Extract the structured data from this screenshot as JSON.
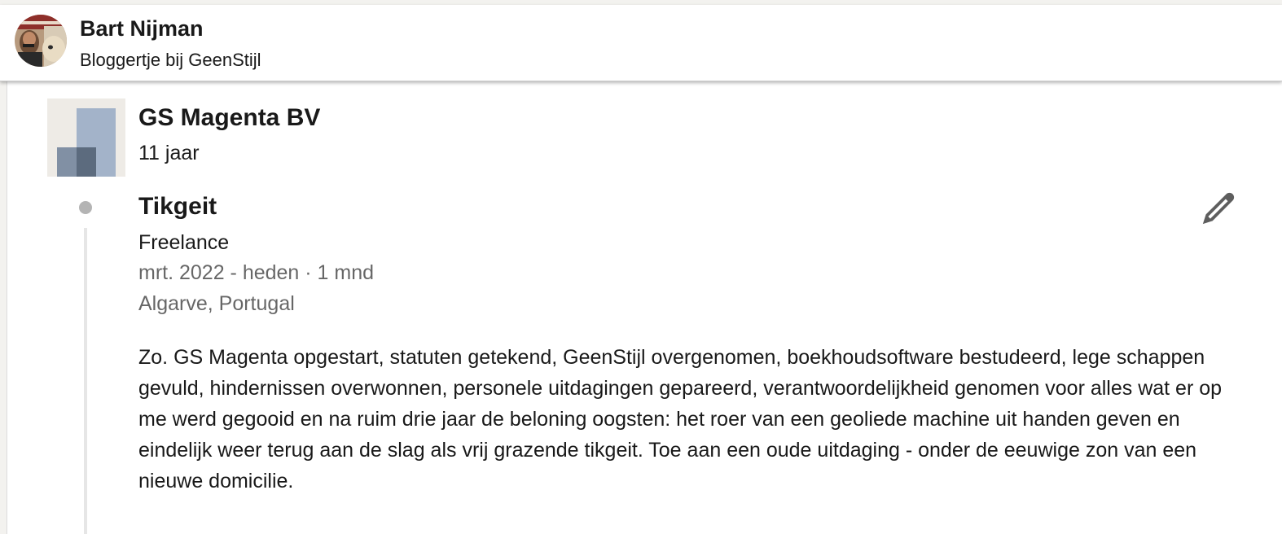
{
  "profile_header": {
    "name": "Bart Nijman",
    "headline": "Bloggertje bij GeenStijl"
  },
  "company": {
    "name": "GS Magenta BV",
    "duration": "11 jaar",
    "logo_icon": "company-placeholder-logo"
  },
  "position": {
    "title": "Tikgeit",
    "employment_type": "Freelance",
    "date_range": "mrt. 2022 - heden · 1 mnd",
    "location": "Algarve, Portugal",
    "description": "Zo. GS Magenta opgestart, statuten getekend, GeenStijl overgenomen, boekhoudsoftware bestudeerd, lege schappen gevuld, hindernissen overwonnen, personele uitdagingen gepareerd, verantwoordelijkheid genomen voor alles wat er op me werd gegooid en na ruim drie jaar de beloning oogsten: het roer van een geoliede machine uit handen geven en eindelijk weer terug aan de slag als vrij grazende tikgeit. Toe aan een oude uitdaging - onder de eeuwige zon van een nieuwe domicilie.",
    "edit_icon": "pencil-icon"
  },
  "colors": {
    "text_primary": "#191919",
    "text_secondary": "#666666",
    "timeline": "#b4b4b4",
    "logo_blue_light": "#a3b3c9",
    "logo_blue_dark": "#5c6b7e"
  }
}
